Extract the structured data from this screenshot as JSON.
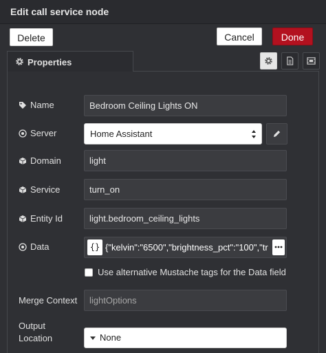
{
  "dialog": {
    "title": "Edit call service node"
  },
  "toolbar": {
    "delete_label": "Delete",
    "cancel_label": "Cancel",
    "done_label": "Done"
  },
  "tabs": {
    "properties_label": "Properties",
    "icons": [
      "gear-icon",
      "document-icon",
      "appearance-icon"
    ]
  },
  "form": {
    "name": {
      "label": "Name",
      "value": "Bedroom Ceiling Lights ON",
      "icon": "tag-icon"
    },
    "server": {
      "label": "Server",
      "value": "Home Assistant",
      "icon": "target-icon"
    },
    "domain": {
      "label": "Domain",
      "value": "light",
      "icon": "cube-icon"
    },
    "service": {
      "label": "Service",
      "value": "turn_on",
      "icon": "cube-icon"
    },
    "entity_id": {
      "label": "Entity Id",
      "value": "light.bedroom_ceiling_lights",
      "icon": "cube-icon"
    },
    "data": {
      "label": "Data",
      "type_label": "{}",
      "value": "{\"kelvin\":\"6500\",\"brightness_pct\":\"100\",\"tr",
      "icon": "target-icon"
    },
    "mustache": {
      "label": "Use alternative Mustache tags for the Data field",
      "checked": false
    },
    "merge_context": {
      "label": "Merge Context",
      "placeholder": "lightOptions"
    },
    "output_location": {
      "label_line1": "Output",
      "label_line2": "Location",
      "value": "None"
    }
  },
  "colors": {
    "background": "#2f3034",
    "done_button": "#b3111f",
    "field_background": "#3b3c40"
  }
}
